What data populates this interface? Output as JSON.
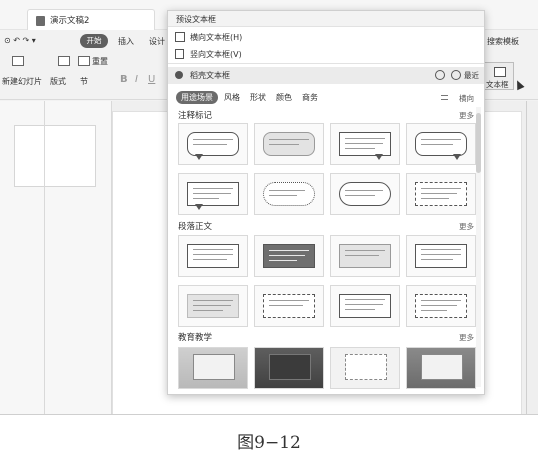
{
  "window": {
    "doc_tab_title": "演示文稿2"
  },
  "menu": {
    "start": "开始",
    "insert": "插入",
    "design": "设计",
    "right_label": "搜索模板"
  },
  "ribbon": {
    "new_slide": "新建幻灯片",
    "layout": "版式",
    "section": "节",
    "reset": "重置",
    "bold": "B",
    "italic": "I",
    "underline": "U",
    "textbox_label": "文本框"
  },
  "dropdown": {
    "header": "预设文本框",
    "items": [
      {
        "label": "横向文本框(H)"
      },
      {
        "label": "竖向文本框(V)"
      }
    ],
    "featured": "稻壳文本框",
    "recent": "最近",
    "tabs": [
      "用途场景",
      "风格",
      "形状",
      "颜色",
      "商务"
    ],
    "active_tab_index": 0,
    "sort_label": "横向",
    "sections": [
      {
        "title": "注释标记",
        "more": "更多"
      },
      {
        "title": "段落正文",
        "more": "更多"
      },
      {
        "title": "教育教学",
        "more": "更多"
      }
    ]
  },
  "caption": "图9−12"
}
